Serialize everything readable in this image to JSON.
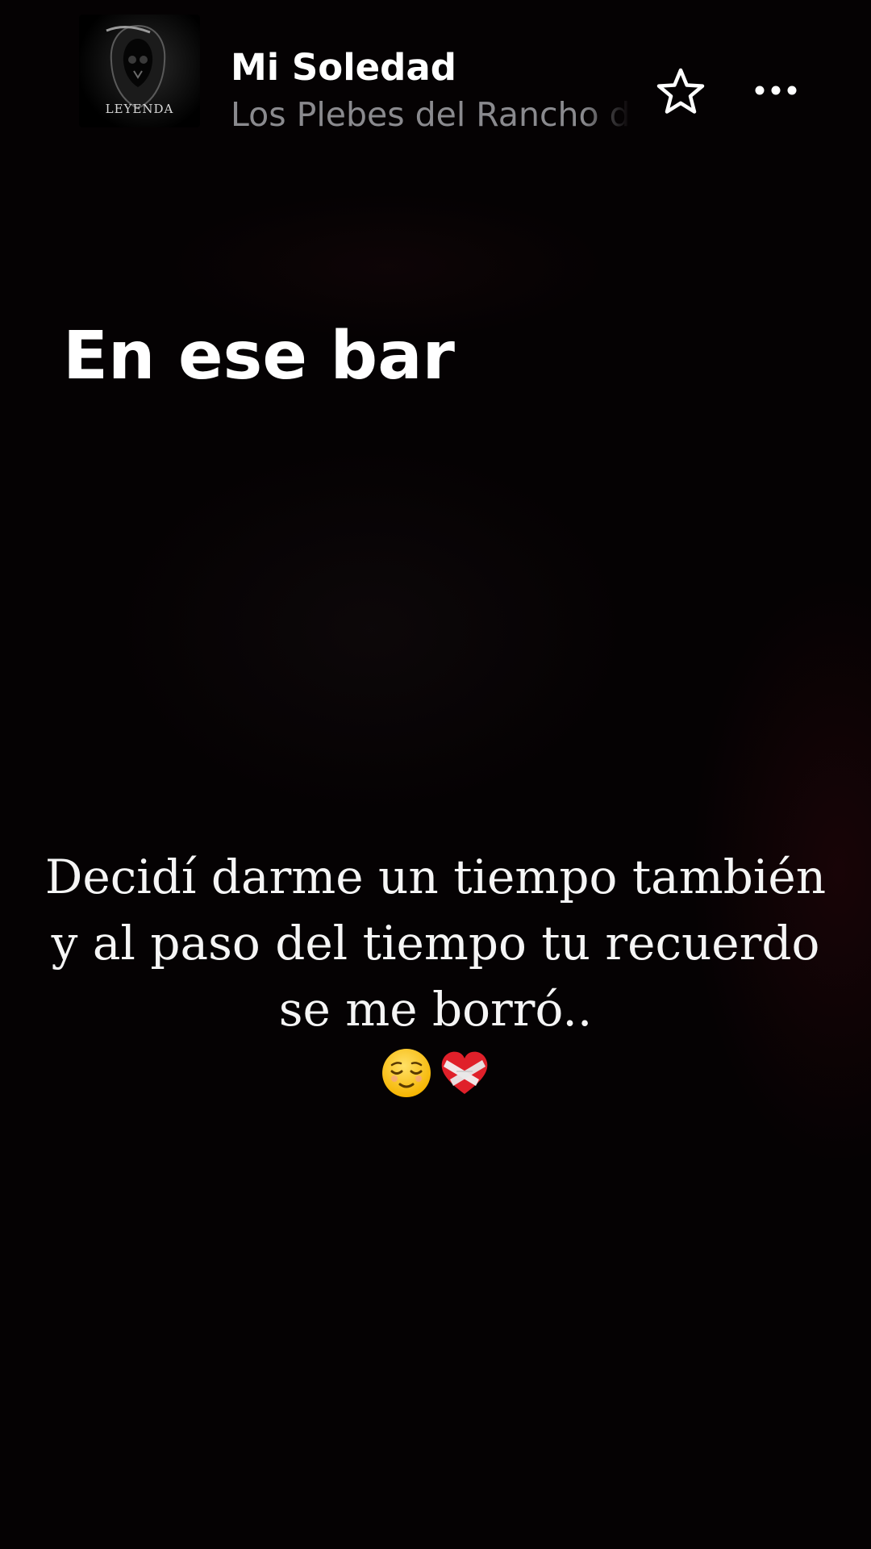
{
  "header": {
    "album_art_text": "LEYENDA",
    "song_title": "Mi Soledad",
    "artist": "Los Plebes del Rancho de Ariel Camacho",
    "favorite_icon": "star-icon",
    "more_icon": "more-horizontal-icon"
  },
  "lyrics": {
    "current_line": "En ese bar"
  },
  "caption": {
    "lines": [
      "Decidí darme un tiempo también",
      "y al paso del tiempo tu recuerdo",
      "se me borró.."
    ],
    "emoji": [
      "relieved-face-emoji",
      "mending-heart-emoji"
    ]
  },
  "colors": {
    "background": "#050203",
    "text_primary": "#ffffff",
    "text_secondary": "#8a8a8e"
  }
}
